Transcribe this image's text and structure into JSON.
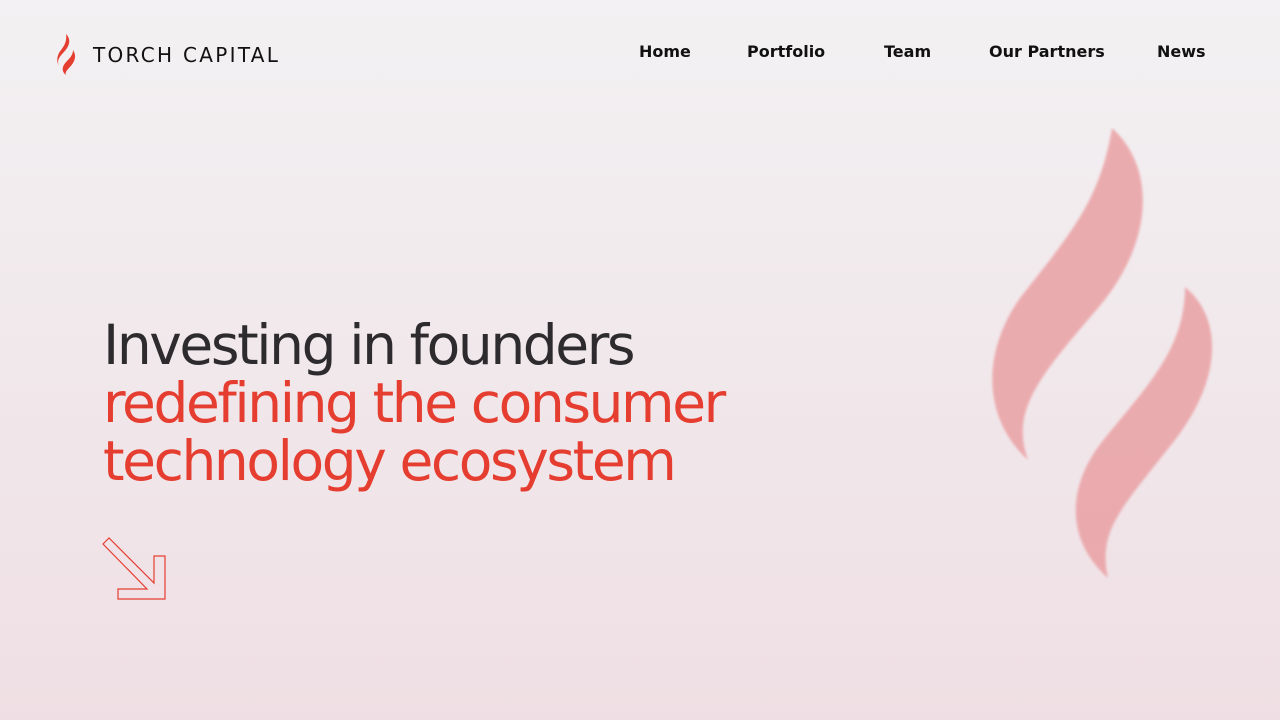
{
  "brand": {
    "name": "TORCH CAPITAL",
    "accent_color": "#e53e31",
    "logo_icon": "flame-logo-icon"
  },
  "nav": {
    "items": [
      {
        "label": "Home"
      },
      {
        "label": "Portfolio"
      },
      {
        "label": "Team"
      },
      {
        "label": "Our Partners"
      },
      {
        "label": "News"
      }
    ]
  },
  "hero": {
    "line1": "Investing in founders",
    "line2": "redefining the consumer",
    "line3": "technology ecosystem",
    "arrow_icon": "arrow-down-right-icon",
    "decoration_icon": "flame-graphic"
  }
}
